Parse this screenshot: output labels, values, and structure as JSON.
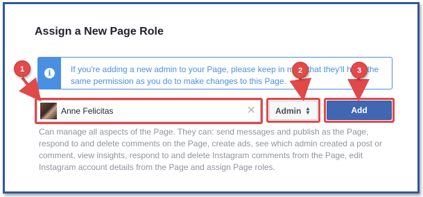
{
  "dialog": {
    "title": "Assign a New Page Role"
  },
  "info": {
    "icon": "info-icon",
    "glyph": "i",
    "text": "If you're adding a new admin to your Page, please keep in mind that they'll have the same permission as you do to make changes to this Page."
  },
  "name_field": {
    "value": "Anne Felicitas",
    "clear_glyph": "✕"
  },
  "role_select": {
    "selected": "Admin",
    "arrow_glyph": "▲▼"
  },
  "add_button": {
    "label": "Add"
  },
  "description": "Can manage all aspects of the Page. They can: send messages and publish as the Page, respond to and delete comments on the Page, create ads, see which admin created a post or comment, view insights, respond to and delete Instagram comments from the Page, edit Instagram account details from the Page and assign Page roles.",
  "annotations": {
    "color": "#e14848",
    "badges": [
      "1",
      "2",
      "3"
    ]
  },
  "colors": {
    "frame": "#30589c",
    "accent": "#4a90e2",
    "button": "#4267b2"
  }
}
